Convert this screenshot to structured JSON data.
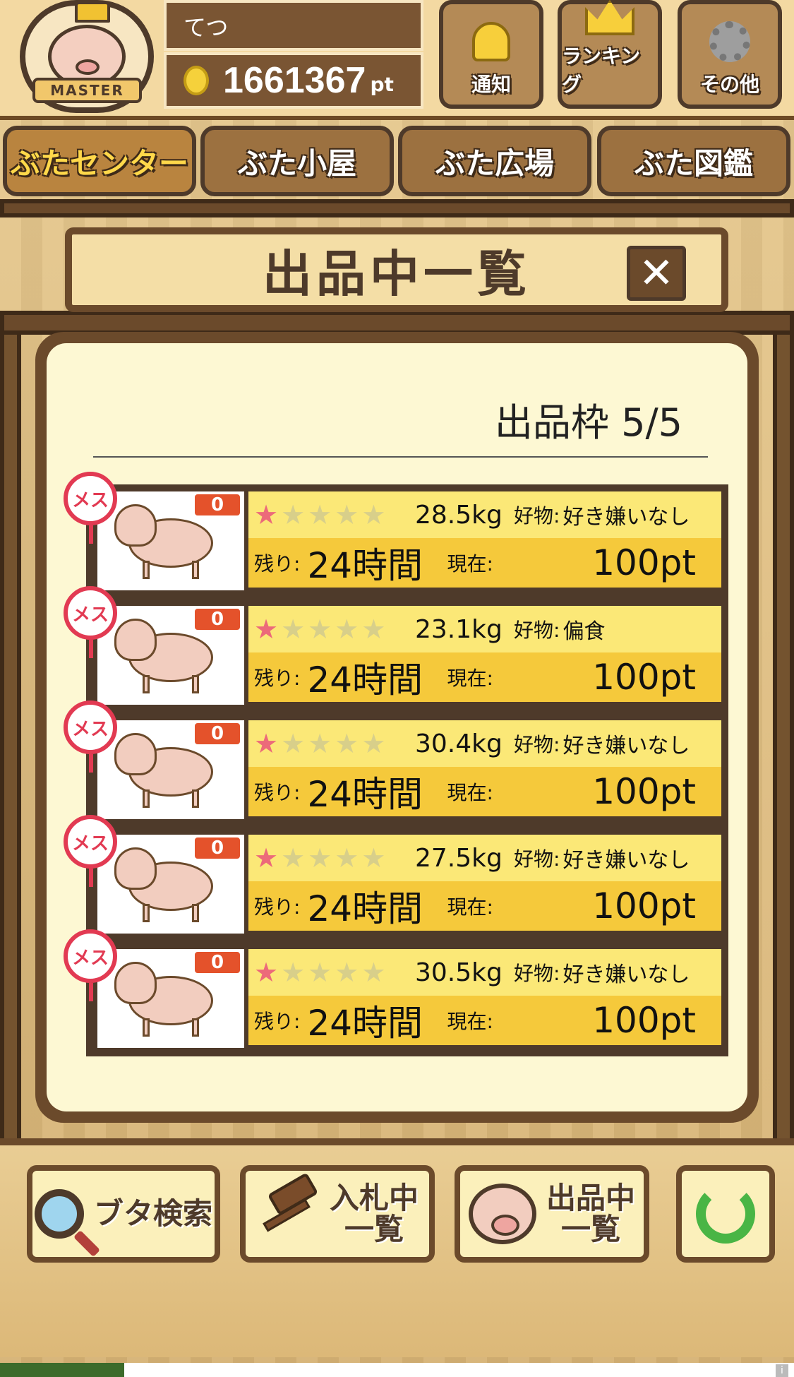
{
  "user": {
    "name": "てつ",
    "points": "1661367",
    "points_unit": "pt",
    "rank_badge": "MASTER"
  },
  "top_buttons": [
    {
      "label": "通知",
      "icon": "bell-icon"
    },
    {
      "label": "ランキング",
      "icon": "crown-icon"
    },
    {
      "label": "その他",
      "icon": "gear-icon"
    }
  ],
  "tabs": [
    {
      "label": "ぶたセンター",
      "active": true
    },
    {
      "label": "ぶた小屋",
      "active": false
    },
    {
      "label": "ぶた広場",
      "active": false
    },
    {
      "label": "ぶた図鑑",
      "active": false
    }
  ],
  "dialog": {
    "title": "出品中一覧",
    "close_label": "✕",
    "slot_label": "出品枠 5/5"
  },
  "listing_labels": {
    "pref": "好物:",
    "remain": "残り:",
    "current": "現在:",
    "gender": "メス"
  },
  "listings": [
    {
      "bids": "0",
      "stars": 1,
      "weight": "28.5kg",
      "pref": "好き嫌いなし",
      "remain": "24時間",
      "current": "100pt"
    },
    {
      "bids": "0",
      "stars": 1,
      "weight": "23.1kg",
      "pref": "偏食",
      "remain": "24時間",
      "current": "100pt"
    },
    {
      "bids": "0",
      "stars": 1,
      "weight": "30.4kg",
      "pref": "好き嫌いなし",
      "remain": "24時間",
      "current": "100pt"
    },
    {
      "bids": "0",
      "stars": 1,
      "weight": "27.5kg",
      "pref": "好き嫌いなし",
      "remain": "24時間",
      "current": "100pt"
    },
    {
      "bids": "0",
      "stars": 1,
      "weight": "30.5kg",
      "pref": "好き嫌いなし",
      "remain": "24時間",
      "current": "100pt"
    }
  ],
  "bottom_buttons": {
    "search": "ブタ検索",
    "bidding_line1": "入札中",
    "bidding_line2": "一覧",
    "listing_line1": "出品中",
    "listing_line2": "一覧"
  },
  "colors": {
    "wood_dark": "#6b4a2b",
    "row_top": "#fbe877",
    "row_bottom": "#f5c93b",
    "gender": "#e23a52",
    "badge": "#e4522b",
    "star_on": "#ec6a7a"
  }
}
